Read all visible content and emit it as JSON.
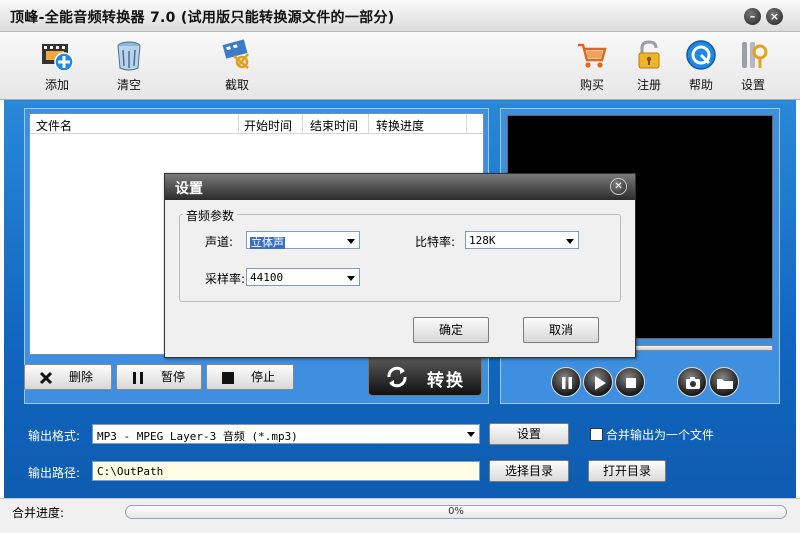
{
  "window": {
    "title": "顶峰-全能音频转换器 7.0 (试用版只能转换源文件的一部分)"
  },
  "toolbar": {
    "add": "添加",
    "clear": "清空",
    "capture": "截取",
    "buy": "购买",
    "register": "注册",
    "help": "帮助",
    "settings": "设置"
  },
  "file_list": {
    "columns": [
      "文件名",
      "开始时间",
      "结束时间",
      "转换进度"
    ]
  },
  "actions": {
    "delete": "删除",
    "pause": "暂停",
    "stop": "停止",
    "convert": "转换"
  },
  "output": {
    "format_label": "输出格式:",
    "format_value": "MP3 - MPEG Layer-3 音频 (*.mp3)",
    "settings_button": "设置",
    "merge_label": "合并输出为一个文件",
    "merge_checked": false,
    "path_label": "输出路径:",
    "path_value": "C:\\OutPath",
    "choose_dir": "选择目录",
    "open_dir": "打开目录"
  },
  "status": {
    "label": "合并进度:",
    "progress_text": "0%",
    "progress": 0
  },
  "dialog": {
    "title": "设置",
    "group": "音频参数",
    "channel_label": "声道:",
    "channel_value": "立体声",
    "bitrate_label": "比特率:",
    "bitrate_value": "128K",
    "samplerate_label": "采样率:",
    "samplerate_value": "44100",
    "ok": "确定",
    "cancel": "取消"
  },
  "colors": {
    "main_blue": "#1166c0",
    "panel_blue": "#3f8fe0",
    "selection": "#3a6fc4"
  },
  "icons": [
    "add-film-icon",
    "clear-bin-icon",
    "capture-scissors-icon",
    "cart-icon",
    "lock-icon",
    "help-icon",
    "gear-icon"
  ]
}
